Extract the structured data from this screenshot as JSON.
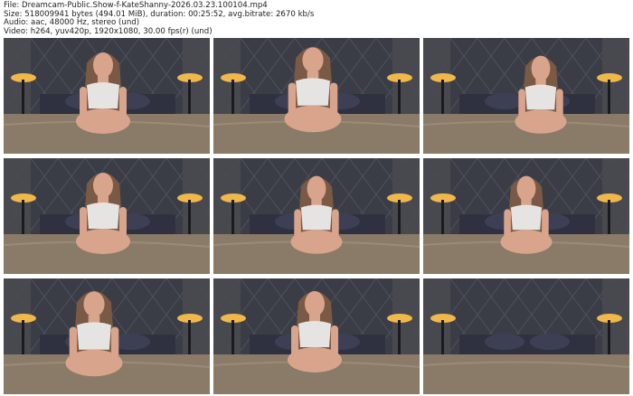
{
  "header": {
    "file_line": "File: Dreamcam-Public.Show-f-KateShanny-2026.03.23.100104.mp4",
    "size_line": "Size: 518009941 bytes (494.01 MiB), duration: 00:25:52, avg.bitrate: 2670 kb/s",
    "audio_line": "Audio: aac, 48000 Hz, stereo (und)",
    "video_line": "Video: h264, yuv420p, 1920x1080, 30.00 fps(r) (und)"
  },
  "colors": {
    "wall": "#3b3d46",
    "bed": "#8a7a68",
    "lamp_glow": "#f0b84a",
    "skin": "#d9a48c",
    "hair": "#7a5a44",
    "top": "#e6e4e2"
  },
  "thumbnails": [
    {
      "index": 1,
      "pose": "seated-looking-down"
    },
    {
      "index": 2,
      "pose": "hand-near-face"
    },
    {
      "index": 3,
      "pose": "seated-right"
    },
    {
      "index": 4,
      "pose": "seated-looking-down"
    },
    {
      "index": 5,
      "pose": "seated-center"
    },
    {
      "index": 6,
      "pose": "seated-center"
    },
    {
      "index": 7,
      "pose": "seated-left"
    },
    {
      "index": 8,
      "pose": "kneeling-center"
    },
    {
      "index": 9,
      "pose": "empty-bed"
    }
  ]
}
